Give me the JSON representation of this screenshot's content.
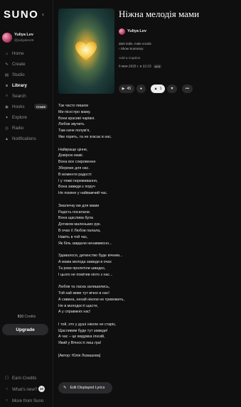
{
  "app": {
    "logo": "SUNO"
  },
  "profile": {
    "name": "Yuliya Lev",
    "handle": "@yuliyalev26"
  },
  "sidebar": {
    "items": [
      {
        "label": "Home",
        "icon": "home-icon"
      },
      {
        "label": "Create",
        "icon": "create-icon"
      },
      {
        "label": "Studio",
        "icon": "studio-icon"
      },
      {
        "label": "Library",
        "icon": "library-icon",
        "active": true
      },
      {
        "label": "Search",
        "icon": "search-icon"
      },
      {
        "label": "Hooks",
        "icon": "hooks-icon",
        "badge": "Create"
      },
      {
        "label": "Explore",
        "icon": "explore-icon"
      },
      {
        "label": "Radio",
        "icon": "radio-icon"
      },
      {
        "label": "Notifications",
        "icon": "bell-icon"
      }
    ],
    "credits_value": "810",
    "credits_label": " Credits",
    "upgrade_label": "Upgrade",
    "bottom": [
      {
        "label": "Earn Credits",
        "icon": "earn-icon"
      },
      {
        "label": "What's new?",
        "icon": "news-icon",
        "count": "20"
      },
      {
        "label": "More from Suno",
        "icon": "more-icon"
      }
    ]
  },
  "song": {
    "title": "Ніжна мелодія мами",
    "artist": "Yuliya Lev",
    "styles": "dark indie, male vocals",
    "show_summary": "› Show Summary",
    "add_caption": "Add a Caption",
    "date": "6 мая 2025 г. в 22:23",
    "version": "v4.5",
    "play_count": "45",
    "like_count": "1",
    "colors": {
      "cover_glow": "#f7d870",
      "cover_dark": "#0e2424"
    }
  },
  "lyrics": {
    "stanzas": [
      [
        "Так часто пишем",
        "Ми пісні про маму.",
        "Вони красиві чарівні.",
        "Любов звучить",
        "Там наче полум'я,",
        "Яке горить, та не згасає в нас."
      ],
      [
        "Найкраще ціннe,",
        "Довірою мамі.",
        "Вона все сокровенне",
        "Збереже для нас.",
        "В моменти радості",
        "І у тяжкі переживання,",
        "Вона завжди є поруч",
        "Не покине у найважчий час."
      ],
      [
        "Змалечку ми для мами",
        "Радість посилали.",
        "Вона щаслива була",
        "Дотиком маленьких рук.",
        "В очах її Любов палала,",
        "Навіть в той час,",
        "Як біль завдали ненавмисно..."
      ],
      [
        "Здавалося, дитинство буде вічним...",
        "А мама молода завжди в очах",
        "Та роки пролетіли швидко,",
        "І цього не помітив ніхто з нас..."
      ],
      [
        "Любов та ласка залишились,",
        "Той хай живе тут вічно в нас!",
        "А сивина, нехай ніколи не тривожить,",
        "Не в молодості щастя,",
        "А у справжніх нас!"
      ],
      [
        "І той, хто у душі ніколи не старіє,",
        "Щасливим буде тут завжди!",
        "А час – це видумка ілюзій,",
        "Який у Вічності лиш гра!"
      ],
      [
        "[Автор: Юлія Лєвашова]"
      ]
    ],
    "edit_label": "Edit Displayed Lyrics"
  }
}
